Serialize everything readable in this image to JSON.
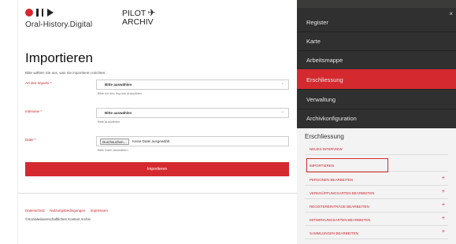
{
  "brand": {
    "logo_text": "Oral-History.Digital",
    "pilot_line1": "PILOT",
    "pilot_line2": "ARCHIV",
    "plane_icon": "✈"
  },
  "page": {
    "title": "Importieren",
    "subtitle": "Bitte wählen Sie aus, was Sie importieren möchten."
  },
  "form": {
    "type": {
      "label": "Art des Imports *",
      "value": "Bitte auswählen",
      "hint": "Bitte Art des Imports auswählen"
    },
    "interview": {
      "label": "Interview *",
      "value": "Bitte auswählen",
      "hint": "Bitte auswählen"
    },
    "file": {
      "label": "Datei *",
      "button": "Durchsuchen…",
      "filename": "Keine Datei ausgewählt.",
      "hint": "Bitte Datei auswählen"
    },
    "submit": "Importieren"
  },
  "footer": {
    "links": [
      "Datenschutz",
      "Nutzungsbedingungen",
      "Impressum"
    ],
    "copyright": "©Sozialwissenschaftliches Kontext Archiv"
  },
  "sidebar": {
    "close_icon": "×",
    "items": [
      "Register",
      "Karte",
      "Arbeitsmappe",
      "Erschliessung",
      "Verwaltung",
      "Archivkonfiguration"
    ],
    "active_index": 3,
    "submenu": {
      "title": "Erschliessung",
      "items": [
        {
          "label": "NEUES INTERVIEW",
          "expandable": false
        },
        {
          "label": "IMPORTIEREN",
          "expandable": false,
          "highlighted": true
        },
        {
          "label": "PERSONEN BEARBEITEN",
          "expandable": true
        },
        {
          "label": "VERKNÜPFUNGSARTEN BEARBEITEN",
          "expandable": true
        },
        {
          "label": "REGISTEREINTRÄGE BEARBEITEN",
          "expandable": true
        },
        {
          "label": "MITWIRKUNGSARTEN BEARBEITEN",
          "expandable": true
        },
        {
          "label": "SAMMLUNGEN BEARBEITEN",
          "expandable": true
        }
      ]
    }
  },
  "colors": {
    "accent": "#d42a2f",
    "sidebar_bg": "#2f302f",
    "submenu_bg": "#f3f3f3"
  }
}
